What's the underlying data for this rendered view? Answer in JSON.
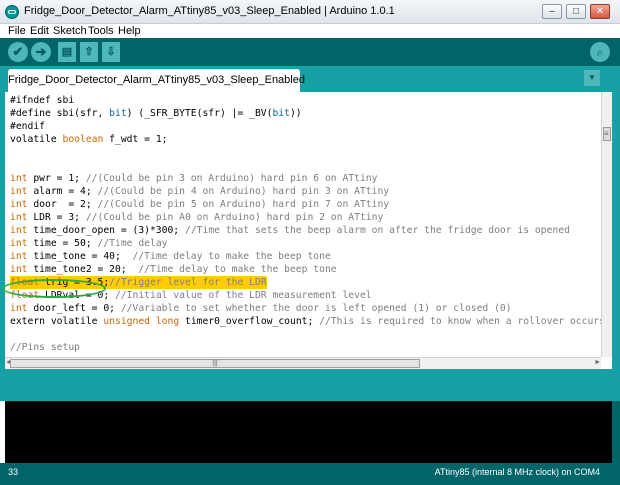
{
  "window": {
    "title": "Fridge_Door_Detector_Alarm_ATtiny85_v03_Sleep_Enabled | Arduino 1.0.1",
    "minimize_label": "–",
    "maximize_label": "□",
    "close_label": "✕"
  },
  "menu": [
    "File",
    "Edit",
    "Sketch",
    "Tools",
    "Help"
  ],
  "toolbar": {
    "verify_glyph": "✔",
    "upload_glyph": "➔",
    "new_glyph": "▤",
    "open_glyph": "⇧",
    "save_glyph": "⇩",
    "serial_glyph": "⌕"
  },
  "tab": {
    "label": "Fridge_Door_Detector_Alarm_ATtiny85_v03_Sleep_Enabled",
    "menu_glyph": "▼"
  },
  "code_lines": [
    [
      [
        "#ifndef sbi",
        ""
      ]
    ],
    [
      [
        "#define sbi(sfr, ",
        ""
      ],
      [
        "bit",
        "v"
      ],
      [
        ") (_SFR_BYTE(sfr) |= _BV(",
        ""
      ],
      [
        "bit",
        "v"
      ],
      [
        "))",
        ""
      ]
    ],
    [
      [
        "#endif",
        ""
      ]
    ],
    [
      [
        "volatile ",
        ""
      ],
      [
        "boolean",
        "k"
      ],
      [
        " f_wdt = 1;",
        ""
      ]
    ],
    [],
    [],
    [
      [
        "int",
        "k"
      ],
      [
        " pwr = 1; ",
        ""
      ],
      [
        "//(Could be pin 3 on Arduino) hard pin 6 on ATtiny",
        "c"
      ]
    ],
    [
      [
        "int",
        "k"
      ],
      [
        " alarm = 4; ",
        ""
      ],
      [
        "//(Could be pin 4 on Arduino) hard pin 3 on ATtiny",
        "c"
      ]
    ],
    [
      [
        "int",
        "k"
      ],
      [
        " door  = 2; ",
        ""
      ],
      [
        "//(Could be pin 5 on Arduino) hard pin 7 on ATtiny",
        "c"
      ]
    ],
    [
      [
        "int",
        "k"
      ],
      [
        " LDR = 3; ",
        ""
      ],
      [
        "//(Could be pin A0 on Arduino) hard pin 2 on ATtiny",
        "c"
      ]
    ],
    [
      [
        "int",
        "k"
      ],
      [
        " time_door_open = (3)*300; ",
        ""
      ],
      [
        "//Time that sets the beep alarm on after the fridge door is opened",
        "c"
      ]
    ],
    [
      [
        "int",
        "k"
      ],
      [
        " time = 50; ",
        ""
      ],
      [
        "//Time delay",
        "c"
      ]
    ],
    [
      [
        "int",
        "k"
      ],
      [
        " time_tone = 40;  ",
        ""
      ],
      [
        "//Time delay to make the beep tone",
        "c"
      ]
    ],
    [
      [
        "int",
        "k"
      ],
      [
        " time_tone2 = 20;  ",
        ""
      ],
      [
        "//Time delay to make the beep tone",
        "c"
      ]
    ],
    [
      [
        "float",
        "k"
      ],
      [
        " trig = 3.5;",
        ""
      ],
      [
        "//Trigger level for the LDR",
        "c"
      ]
    ],
    [
      [
        "float",
        "k"
      ],
      [
        " LDRval = 0; ",
        ""
      ],
      [
        "//Initial value of the LDR measurement level",
        "c"
      ]
    ],
    [
      [
        "int",
        "k"
      ],
      [
        " door_left = 0; ",
        ""
      ],
      [
        "//Variable to set whether the door is left opened (1) or closed (0)",
        "c"
      ]
    ],
    [
      [
        "extern volatile ",
        ""
      ],
      [
        "unsigned",
        "k"
      ],
      [
        " ",
        ""
      ],
      [
        "long",
        "k"
      ],
      [
        " timer0_overflow_count; ",
        ""
      ],
      [
        "//This is required to know when a rollover occurs",
        "c"
      ]
    ],
    [],
    [
      [
        "//Pins setup",
        "c"
      ]
    ]
  ],
  "highlight_line": 14,
  "scroll": {
    "h_left_glyph": "◄",
    "h_right_glyph": "►",
    "h_grip_glyph": "|||",
    "v_grip_glyph": "≡"
  },
  "status": {
    "line_number": "33",
    "board": "ATtiny85 (internal 8 MHz clock) on COM4"
  },
  "colors": {
    "toolbar_bg": "#006468",
    "tab_strip_bg": "#17a1a5",
    "keyword": "#cc6600",
    "comment": "#7e7e7e",
    "highlight": "#ffcc00",
    "annotation": "#2bab3c"
  }
}
